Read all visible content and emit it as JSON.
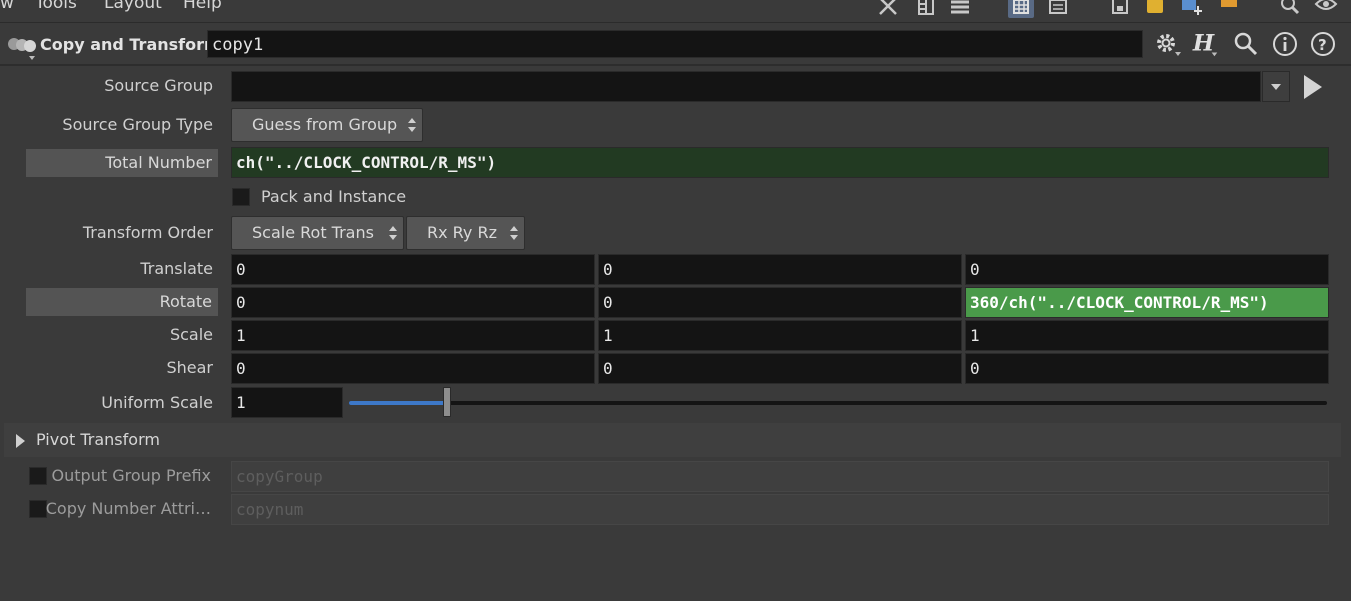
{
  "menubar": {
    "items": [
      "w",
      "Tools",
      "Layout",
      "Help"
    ]
  },
  "header": {
    "node_type": "Copy and Transform",
    "node_name": "copy1",
    "icons": [
      "gear-icon",
      "houdini-help-icon",
      "search-icon",
      "info-icon",
      "help-icon"
    ]
  },
  "parms": {
    "source_group": {
      "label": "Source Group",
      "value": ""
    },
    "source_group_type": {
      "label": "Source Group Type",
      "value": "Guess from Group"
    },
    "total_number": {
      "label": "Total Number",
      "value": "ch(\"../CLOCK_CONTROL/R_MS\")"
    },
    "pack_instance": {
      "label": "Pack and Instance",
      "checked": false
    },
    "transform_order": {
      "label": "Transform Order",
      "value": "Scale Rot Trans",
      "rot_order": "Rx Ry Rz"
    },
    "translate": {
      "label": "Translate",
      "x": "0",
      "y": "0",
      "z": "0"
    },
    "rotate": {
      "label": "Rotate",
      "x": "0",
      "y": "0",
      "z": "360/ch(\"../CLOCK_CONTROL/R_MS\")"
    },
    "scale": {
      "label": "Scale",
      "x": "1",
      "y": "1",
      "z": "1"
    },
    "shear": {
      "label": "Shear",
      "x": "0",
      "y": "0",
      "z": "0"
    },
    "uniform_scale": {
      "label": "Uniform Scale",
      "value": "1",
      "slider_fraction": 0.1
    },
    "pivot_folder": {
      "label": "Pivot Transform"
    },
    "output_group_prefix": {
      "label": "Output Group Prefix",
      "value": "copyGroup",
      "checked": false
    },
    "copy_number_attrib": {
      "label": "Copy Number Attri…",
      "value": "copynum",
      "checked": false
    }
  },
  "colors": {
    "expression_dark": "#223a22",
    "expression_bright": "#4a9a4a",
    "slider_fill": "#3d78c8"
  }
}
